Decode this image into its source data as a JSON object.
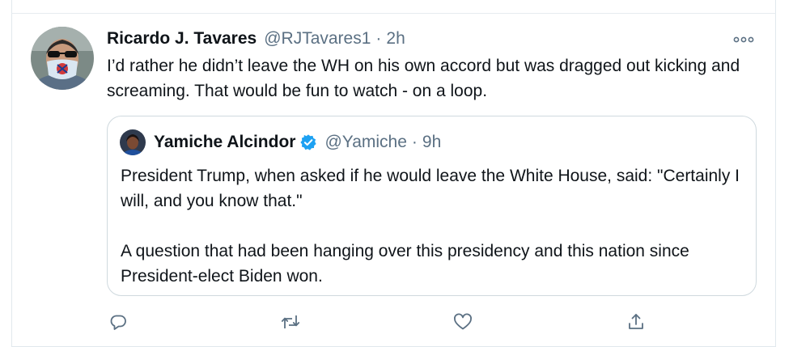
{
  "tweet": {
    "author_name": "Ricardo J. Tavares",
    "author_handle": "@RJTavares1",
    "separator": "·",
    "time": "2h",
    "text": "I’d rather he didn’t leave the WH on his own accord but was dragged out kicking and screaming. That would be fun to watch - on a loop.",
    "more_icon": "more-horizontal-icon"
  },
  "quoted_tweet": {
    "author_name": "Yamiche Alcindor",
    "author_handle": "@Yamiche",
    "separator": "·",
    "time": "9h",
    "verified": true,
    "paragraphs": [
      "President Trump, when asked if he would leave the White House, said: \"Certainly I will, and you know that.\"",
      "A question that had been hanging over this presidency and this nation since President-elect Biden won."
    ]
  },
  "actions": [
    {
      "icon": "reply-icon"
    },
    {
      "icon": "retweet-icon"
    },
    {
      "icon": "like-icon"
    },
    {
      "icon": "share-icon"
    }
  ],
  "colors": {
    "text_primary": "#0f1419",
    "text_secondary": "#5b7083",
    "verified_blue": "#1da1f2",
    "border": "#cfd9de"
  }
}
